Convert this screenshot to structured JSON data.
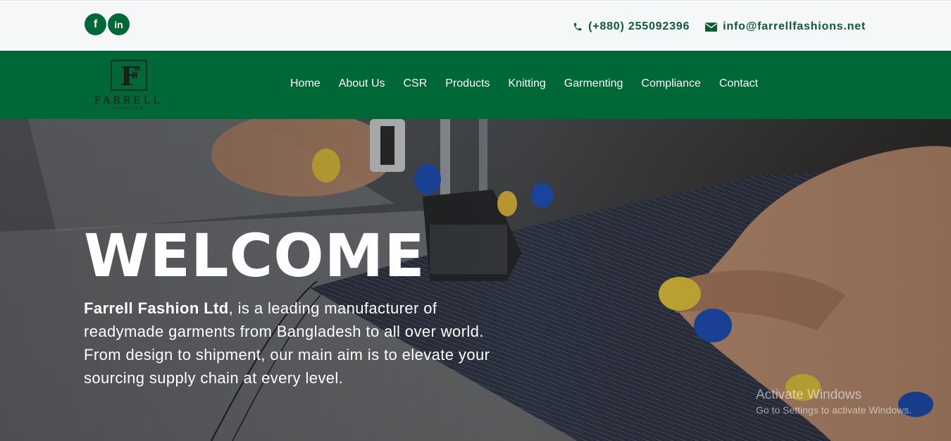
{
  "topbar": {
    "social": [
      {
        "name": "facebook-icon",
        "glyph": "f"
      },
      {
        "name": "linkedin-icon",
        "glyph": "in"
      }
    ],
    "phone": "(+880) 255092396",
    "email": "info@farrellfashions.net"
  },
  "logo": {
    "monogram": "FF",
    "name": "FARRELL",
    "sub": "FASHIONS"
  },
  "nav": {
    "items": [
      "Home",
      "About Us",
      "CSR",
      "Products",
      "Knitting",
      "Garmenting",
      "Compliance",
      "Contact"
    ]
  },
  "hero": {
    "heading": "WELCOME",
    "company": "Farrell Fashion Ltd",
    "text": ", is a leading manufacturer of readymade garments from Bangladesh to all over world. From design to shipment, our main aim is to elevate your sourcing supply chain at every level."
  },
  "os_watermark": {
    "title": "Activate Windows",
    "subtitle": "Go to Settings to activate Windows."
  },
  "colors": {
    "brand_green": "#006837",
    "topbar_bg": "#f6f7f9",
    "text_green": "#0f5a33"
  }
}
